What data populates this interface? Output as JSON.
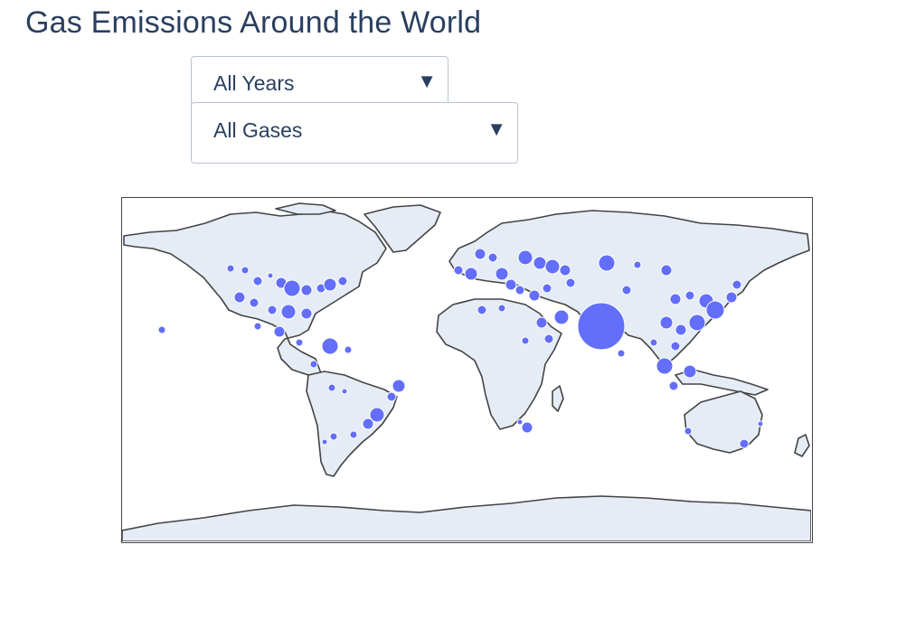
{
  "page": {
    "title": "Gas Emissions Around the World"
  },
  "filters": {
    "years": {
      "selected": "All Years"
    },
    "gases": {
      "selected": "All Gases"
    }
  },
  "icons": {
    "dropdown_arrow": "caret-down-icon"
  },
  "colors": {
    "title": "#2a3f5f",
    "land": "#e5ecf6",
    "coastline": "#444444",
    "marker": "#636efa",
    "marker_outline": "#ffffff"
  },
  "map_data": {
    "projection": "equirectangular",
    "marker_type": "bubble"
  }
}
